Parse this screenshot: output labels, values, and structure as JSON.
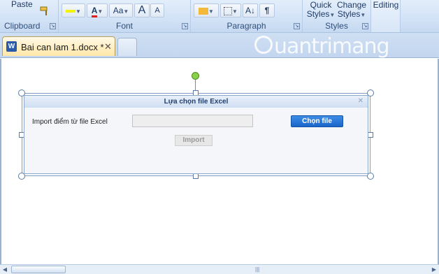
{
  "ribbon": {
    "clipboard": {
      "paste_label": "Paste",
      "group_label": "Clipboard"
    },
    "font": {
      "group_label": "Font",
      "grow_label": "A",
      "shrink_label": "A",
      "change_case_label": "Aa",
      "font_color_label": "A"
    },
    "paragraph": {
      "group_label": "Paragraph",
      "show_marks_label": "¶",
      "sort_label": "A↓"
    },
    "styles": {
      "quick_styles_line1": "Quick",
      "quick_styles_line2": "Styles",
      "change_styles_line1": "Change",
      "change_styles_line2": "Styles",
      "group_label": "Styles"
    },
    "editing": {
      "label": "Editing"
    }
  },
  "tabs": {
    "document_title": "Bai can lam 1.docx *",
    "word_icon_letter": "W",
    "close_symbol": "✕"
  },
  "watermark": {
    "text": "uantrimang"
  },
  "dialog": {
    "title": "Lựa chọn file Excel",
    "close_symbol": "✕",
    "import_label": "Import điểm từ file Excel",
    "file_input_value": "",
    "choose_button": "Chọn file",
    "import_button": "Import"
  },
  "colors": {
    "accent_blue": "#1a66c9",
    "rotation_handle": "#8ad04a",
    "font_color_underline": "#e02020"
  }
}
